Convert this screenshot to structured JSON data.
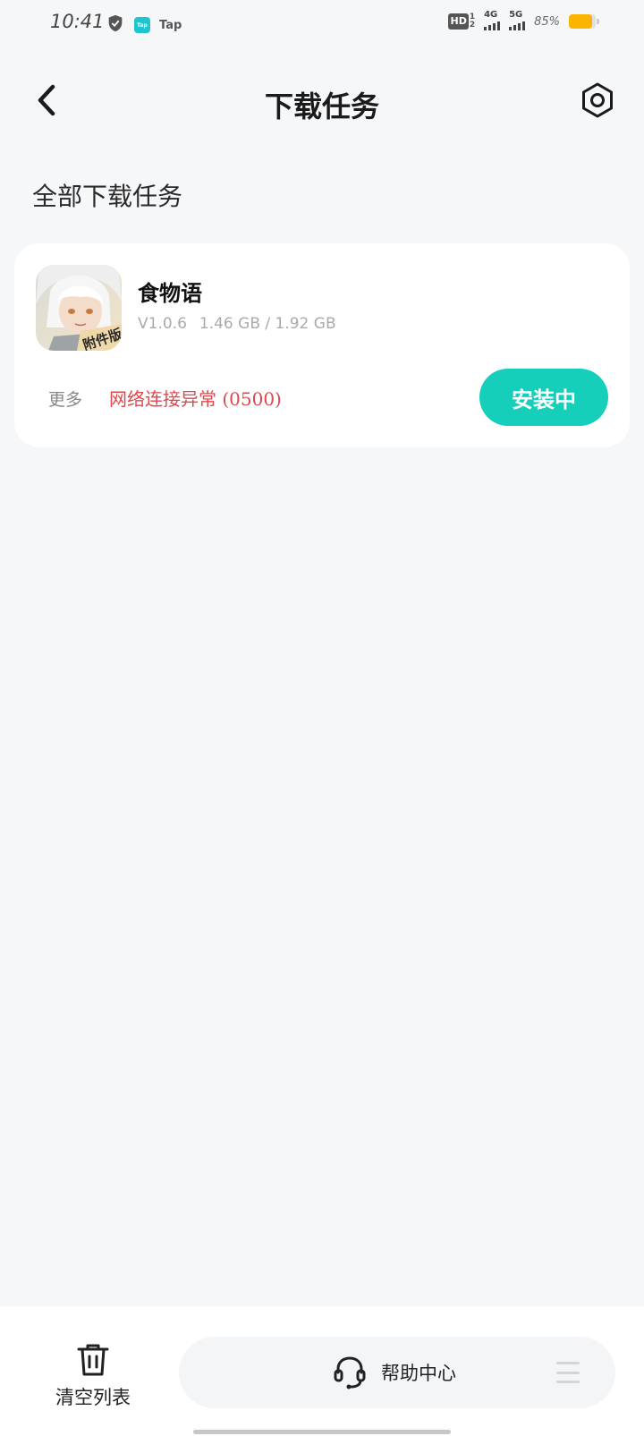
{
  "status_bar": {
    "time": "10:41",
    "tap_small": "Tap",
    "tap_text": "Tap",
    "hd_label": "HD",
    "hd_sub_top": "1",
    "hd_sub_bottom": "2",
    "net1": "4G",
    "net2": "5G",
    "battery_pct": "85%",
    "battery_level": 0.85,
    "battery_color": "#fbb500"
  },
  "header": {
    "back_icon": "chevron-left-icon",
    "title": "下载任务",
    "settings_icon": "hexagon-settings-icon"
  },
  "section": {
    "title": "全部下载任务"
  },
  "task": {
    "app_name": "食物语",
    "app_badge": "附件版",
    "version": "V1.0.6",
    "progress_text": "1.46 GB / 1.92 GB",
    "more_label": "更多",
    "error_text": "网络连接异常 (0500)",
    "error_color": "#e0474c",
    "action_label": "安装中",
    "action_color": "#16cfbb"
  },
  "bottom_bar": {
    "clear_label": "清空列表",
    "clear_icon": "trash-icon",
    "help_label": "帮助中心",
    "help_icon": "headset-icon",
    "menu_icon": "menu-icon"
  }
}
